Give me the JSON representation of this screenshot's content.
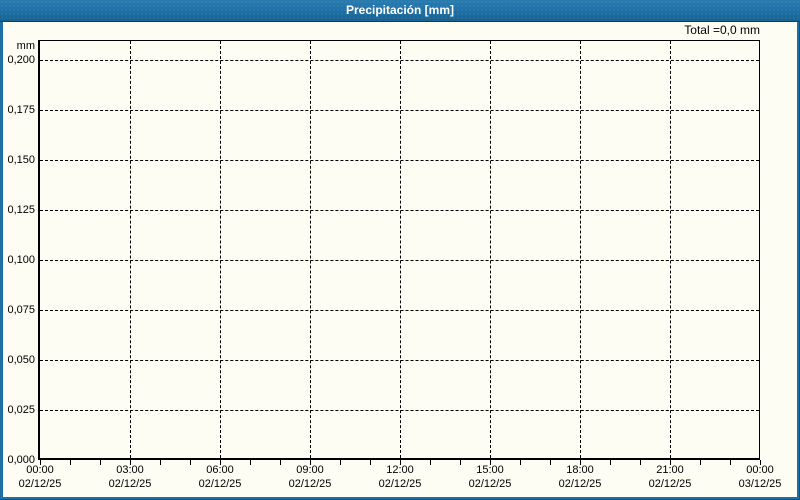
{
  "header": {
    "title": "Precipitación [mm]"
  },
  "colors": {
    "header_bg": "#1E6FA5",
    "header_border_bottom": "#0B4165",
    "frame_bg": "#1E6FA5",
    "canvas_bg": "#FDFDF4",
    "plot_border": "#000000",
    "grid": "#000000",
    "text": "#000000",
    "title_text": "#FFFFFF"
  },
  "chart_data": {
    "type": "line",
    "title": "Precipitación [mm]",
    "ylabel": "mm",
    "ylim": [
      0,
      0.21
    ],
    "x_hours_range": [
      0,
      24
    ],
    "x_minor_tick_hours": 1,
    "grid": true,
    "total_label": "Total =0,0 mm",
    "total_mm": "0,0",
    "y_ticks": [
      {
        "value": 0.2,
        "label": "0,200"
      },
      {
        "value": 0.175,
        "label": "0,175"
      },
      {
        "value": 0.15,
        "label": "0,150"
      },
      {
        "value": 0.125,
        "label": "0,125"
      },
      {
        "value": 0.1,
        "label": "0,100"
      },
      {
        "value": 0.075,
        "label": "0,075"
      },
      {
        "value": 0.05,
        "label": "0,050"
      },
      {
        "value": 0.025,
        "label": "0,025"
      },
      {
        "value": 0.0,
        "label": "0,000"
      }
    ],
    "x_ticks": [
      {
        "hour": 0,
        "time": "00:00",
        "date": "02/12/25"
      },
      {
        "hour": 3,
        "time": "03:00",
        "date": "02/12/25"
      },
      {
        "hour": 6,
        "time": "06:00",
        "date": "02/12/25"
      },
      {
        "hour": 9,
        "time": "09:00",
        "date": "02/12/25"
      },
      {
        "hour": 12,
        "time": "12:00",
        "date": "02/12/25"
      },
      {
        "hour": 15,
        "time": "15:00",
        "date": "02/12/25"
      },
      {
        "hour": 18,
        "time": "18:00",
        "date": "02/12/25"
      },
      {
        "hour": 21,
        "time": "21:00",
        "date": "02/12/25"
      },
      {
        "hour": 24,
        "time": "00:00",
        "date": "03/12/25"
      }
    ],
    "series": [
      {
        "name": "Precipitación",
        "values": []
      }
    ]
  }
}
